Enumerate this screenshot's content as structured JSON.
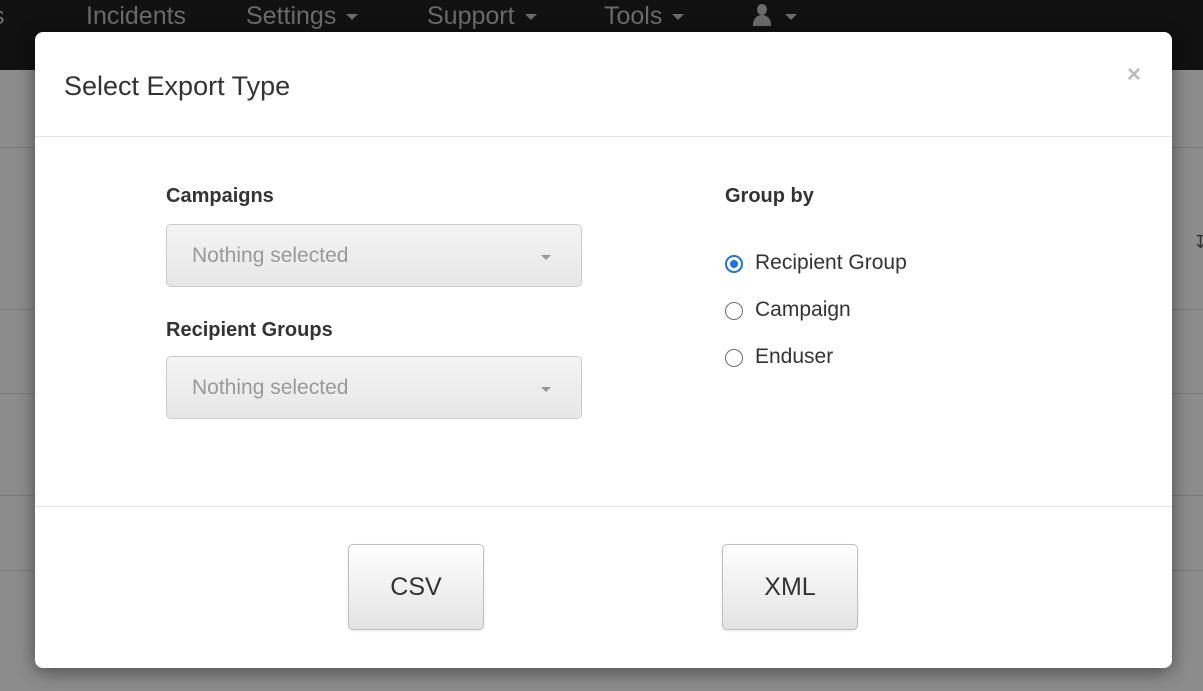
{
  "background": {
    "nav": {
      "items": [
        "s",
        "Incidents",
        "Settings",
        "Support",
        "Tools"
      ]
    }
  },
  "modal": {
    "title": "Select Export Type",
    "close_symbol": "×",
    "campaigns": {
      "label": "Campaigns",
      "value": "Nothing selected"
    },
    "recipient_groups": {
      "label": "Recipient Groups",
      "value": "Nothing selected"
    },
    "group_by": {
      "label": "Group by",
      "options": [
        {
          "label": "Recipient Group",
          "checked": true
        },
        {
          "label": "Campaign",
          "checked": false
        },
        {
          "label": "Enduser",
          "checked": false
        }
      ]
    },
    "buttons": {
      "csv": "CSV",
      "xml": "XML"
    }
  },
  "colors": {
    "accent": "#1a73e8",
    "overlay": "#8c8c8c",
    "navbar": "#111111"
  },
  "icons": {
    "close": "close-icon",
    "dropdown": "chevron-down-icon",
    "user": "user-icon"
  }
}
